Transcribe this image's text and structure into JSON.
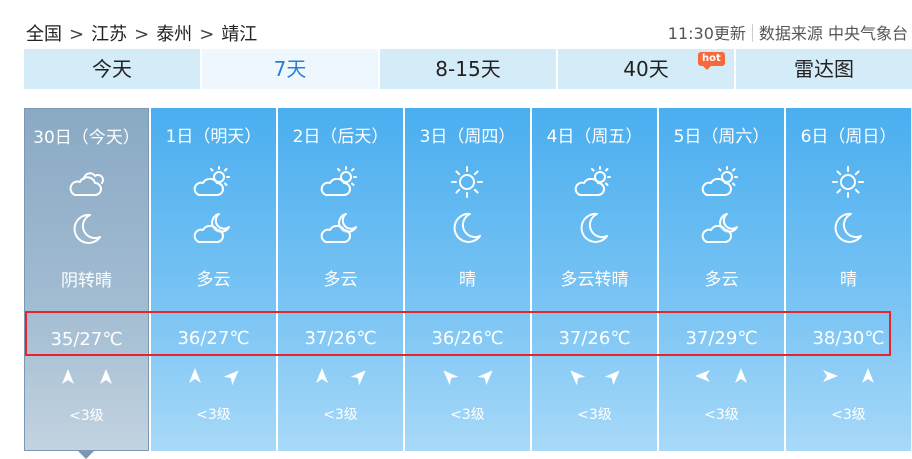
{
  "breadcrumb": {
    "items": [
      "全国",
      "江苏",
      "泰州",
      "靖江"
    ],
    "sep": ">"
  },
  "update": {
    "time_text": "11:30更新",
    "source_text": "数据来源 中央气象台"
  },
  "tabs": [
    {
      "label": "今天"
    },
    {
      "label": "7天",
      "active": true
    },
    {
      "label": "8-15天"
    },
    {
      "label": "40天",
      "badge": "hot"
    },
    {
      "label": "雷达图"
    }
  ],
  "days": [
    {
      "date": "30日（今天）",
      "day_icon": "cloudy-icon",
      "night_icon": "moon-icon",
      "weather": "阴转晴",
      "temp": "35/27℃",
      "wind_dirs": [
        "north",
        "north"
      ],
      "wind_level": "<3级",
      "today": true
    },
    {
      "date": "1日（明天）",
      "day_icon": "partly-cloudy-icon",
      "night_icon": "cloudy-night-icon",
      "weather": "多云",
      "temp": "36/27℃",
      "wind_dirs": [
        "north",
        "northeast"
      ],
      "wind_level": "<3级"
    },
    {
      "date": "2日（后天）",
      "day_icon": "partly-cloudy-icon",
      "night_icon": "cloudy-night-icon",
      "weather": "多云",
      "temp": "37/26℃",
      "wind_dirs": [
        "north",
        "northeast"
      ],
      "wind_level": "<3级"
    },
    {
      "date": "3日（周四）",
      "day_icon": "sun-icon",
      "night_icon": "moon-icon",
      "weather": "晴",
      "temp": "36/26℃",
      "wind_dirs": [
        "northwest",
        "northeast"
      ],
      "wind_level": "<3级"
    },
    {
      "date": "4日（周五）",
      "day_icon": "partly-cloudy-icon",
      "night_icon": "moon-icon",
      "weather": "多云转晴",
      "temp": "37/26℃",
      "wind_dirs": [
        "northwest",
        "northeast"
      ],
      "wind_level": "<3级"
    },
    {
      "date": "5日（周六）",
      "day_icon": "partly-cloudy-icon",
      "night_icon": "cloudy-night-icon",
      "weather": "多云",
      "temp": "37/29℃",
      "wind_dirs": [
        "west",
        "north"
      ],
      "wind_level": "<3级"
    },
    {
      "date": "6日（周日）",
      "day_icon": "sun-icon",
      "night_icon": "moon-icon",
      "weather": "晴",
      "temp": "38/30℃",
      "wind_dirs": [
        "east",
        "north"
      ],
      "wind_level": "<3级"
    }
  ]
}
